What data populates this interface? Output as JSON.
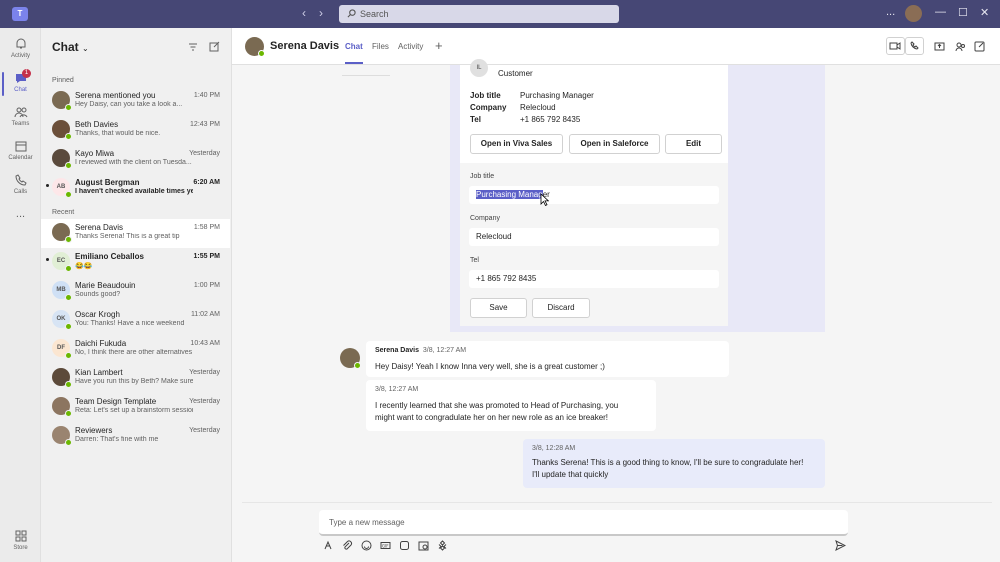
{
  "app": {
    "search_placeholder": "Search",
    "window_controls": [
      "...",
      "—",
      "☐",
      "✕"
    ]
  },
  "rail": [
    {
      "label": "Activity",
      "icon": "bell-icon"
    },
    {
      "label": "Chat",
      "icon": "chat-icon",
      "badge": "1",
      "active": true
    },
    {
      "label": "Teams",
      "icon": "teams-icon"
    },
    {
      "label": "Calendar",
      "icon": "calendar-icon"
    },
    {
      "label": "Calls",
      "icon": "phone-icon"
    },
    {
      "label": "...",
      "icon": "more-icon"
    },
    {
      "label": "Store",
      "icon": "store-icon"
    }
  ],
  "chatlist": {
    "title": "Chat",
    "pinned_label": "Pinned",
    "recent_label": "Recent",
    "pinned": [
      {
        "name": "Serena mentioned you",
        "preview": "Hey Daisy, can you take a look a...",
        "time": "1:40 PM",
        "color": "#7a6a52",
        "initials": ""
      },
      {
        "name": "Beth Davies",
        "preview": "Thanks, that would be nice.",
        "time": "12:43 PM",
        "color": "#6b4f3a",
        "initials": ""
      },
      {
        "name": "Kayo Miwa",
        "preview": "I reviewed with the client on Tuesda...",
        "time": "Yesterday",
        "color": "#5a4a3c",
        "initials": ""
      },
      {
        "name": "August Bergman",
        "preview": "I haven't checked available times yet",
        "time": "6:20 AM",
        "color": "#fde7e9",
        "initials": "AB",
        "unread": true
      }
    ],
    "recent": [
      {
        "name": "Serena Davis",
        "preview": "Thanks Serena! This is a great tip",
        "time": "1:58 PM",
        "color": "#7a6a52",
        "initials": "",
        "selected": true
      },
      {
        "name": "Emiliano Ceballos",
        "preview": "😂😂",
        "time": "1:55 PM",
        "color": "#e1efd5",
        "initials": "EC",
        "unread": true
      },
      {
        "name": "Marie Beaudouin",
        "preview": "Sounds good?",
        "time": "1:00 PM",
        "color": "#cfe0f5",
        "initials": "MB"
      },
      {
        "name": "Oscar Krogh",
        "preview": "You: Thanks! Have a nice weekend",
        "time": "11:02 AM",
        "color": "#d7e4f4",
        "initials": "OK"
      },
      {
        "name": "Daichi Fukuda",
        "preview": "No, I think there are other alternatives we c...",
        "time": "10:43 AM",
        "color": "#fbe6d1",
        "initials": "DF"
      },
      {
        "name": "Kian Lambert",
        "preview": "Have you run this by Beth? Make sure she i...",
        "time": "Yesterday",
        "color": "#5c4a3a",
        "initials": ""
      },
      {
        "name": "Team Design Template",
        "preview": "Reta: Let's set up a brainstorm session for...",
        "time": "Yesterday",
        "color": "#8c7560",
        "initials": ""
      },
      {
        "name": "Reviewers",
        "preview": "Darren: That's fine with me",
        "time": "Yesterday",
        "color": "#9a8470",
        "initials": ""
      }
    ]
  },
  "header": {
    "name": "Serena Davis",
    "tabs": [
      "Chat",
      "Files",
      "Activity"
    ],
    "add": "+"
  },
  "card": {
    "initials": "IL",
    "role": "Customer",
    "fields": [
      {
        "key": "Job title",
        "value": "Purchasing Manager"
      },
      {
        "key": "Company",
        "value": "Relecloud"
      },
      {
        "key": "Tel",
        "value": "+1 865 792 8435"
      }
    ],
    "buttons": [
      "Open in Viva Sales",
      "Open in Saleforce",
      "Edit"
    ],
    "form": {
      "job_label": "Job title",
      "job_selected": "Purchasing Manag",
      "job_rest": "er",
      "company_label": "Company",
      "company_value": "Relecloud",
      "tel_label": "Tel",
      "tel_value": "+1 865 792 8435",
      "save": "Save",
      "discard": "Discard"
    }
  },
  "messages": [
    {
      "sender": "Serena Davis",
      "time": "3/8, 12:27 AM",
      "text": "Hey Daisy! Yeah I know Inna very well, she is a great customer ;)"
    },
    {
      "time": "3/8, 12:27 AM",
      "text1": "I recently learned that she was promoted to Head of Purchasing, you",
      "text2": "might want to congradulate her on her new role as an ice breaker!"
    },
    {
      "time": "3/8, 12:28 AM",
      "text1": "Thanks Serena! This is a good thing to know, I'll be sure to congradulate her!",
      "text2": "I'll update that quickly"
    }
  ],
  "compose": {
    "placeholder": "Type a new message"
  }
}
